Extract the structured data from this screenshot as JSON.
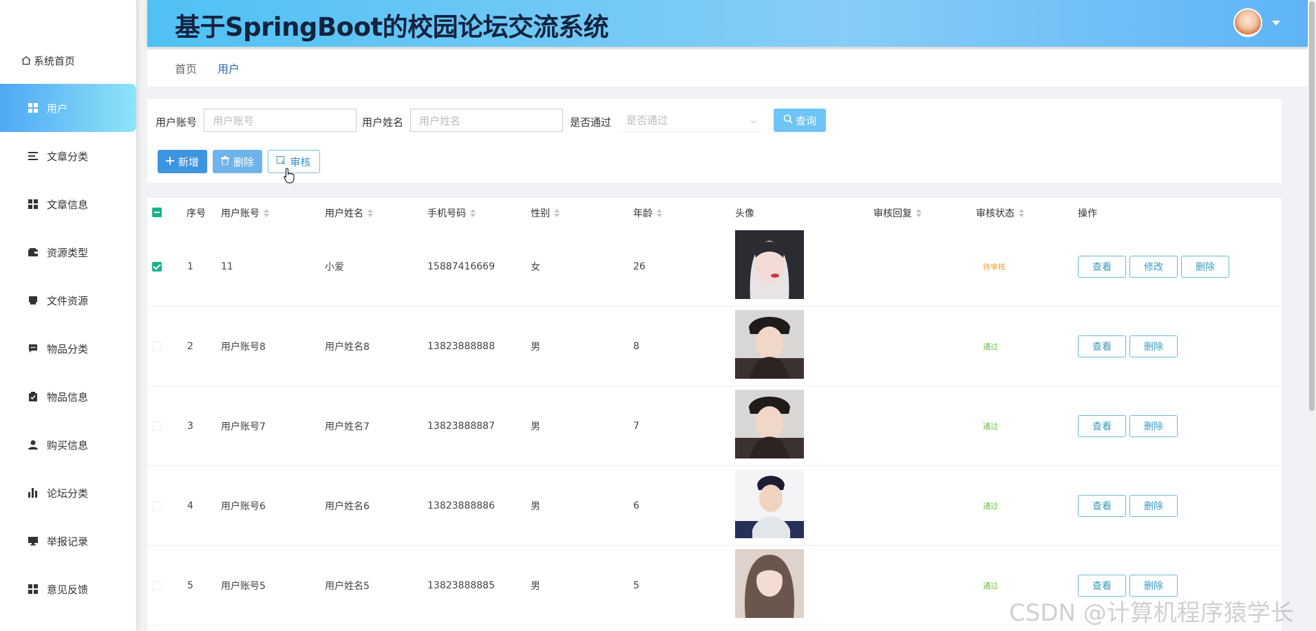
{
  "app": {
    "title": "基于SpringBoot的校园论坛交流系统"
  },
  "colors": {
    "accent": "#4fa8f5",
    "success": "#19b28a",
    "pending": "#e6a23c",
    "approved": "#67c23a"
  },
  "sidebar": {
    "home": {
      "label": "系统首页",
      "icon": "home-icon"
    },
    "items": [
      {
        "label": "用户",
        "icon": "grid-icon",
        "active": true
      },
      {
        "label": "文章分类",
        "icon": "list-icon"
      },
      {
        "label": "文章信息",
        "icon": "grid-icon"
      },
      {
        "label": "资源类型",
        "icon": "wallet-icon"
      },
      {
        "label": "文件资源",
        "icon": "printer-icon"
      },
      {
        "label": "物品分类",
        "icon": "chat-icon"
      },
      {
        "label": "物品信息",
        "icon": "clipboard-check-icon"
      },
      {
        "label": "购买信息",
        "icon": "user-icon"
      },
      {
        "label": "论坛分类",
        "icon": "bar-chart-icon"
      },
      {
        "label": "举报记录",
        "icon": "monitor-icon"
      },
      {
        "label": "意见反馈",
        "icon": "grid-icon"
      }
    ]
  },
  "breadcrumb": {
    "home": "首页",
    "current": "用户"
  },
  "search": {
    "account_label": "用户账号",
    "account_placeholder": "用户账号",
    "name_label": "用户姓名",
    "name_placeholder": "用户姓名",
    "passed_label": "是否通过",
    "passed_placeholder": "是否通过",
    "search_button": "查询"
  },
  "toolbar": {
    "add": "新增",
    "delete": "删除",
    "audit": "审核"
  },
  "table": {
    "headers": {
      "index": "序号",
      "account": "用户账号",
      "name": "用户姓名",
      "phone": "手机号码",
      "gender": "性别",
      "age": "年龄",
      "avatar": "头像",
      "reply": "审核回复",
      "status": "审核状态",
      "actions": "操作"
    },
    "rows": [
      {
        "index": "1",
        "account": "11",
        "name": "小爱",
        "phone": "15887416669",
        "gender": "女",
        "age": "26",
        "status": "待审核",
        "checked": true
      },
      {
        "index": "2",
        "account": "用户账号8",
        "name": "用户姓名8",
        "phone": "13823888888",
        "gender": "男",
        "age": "8",
        "status": "通过",
        "checked": false
      },
      {
        "index": "3",
        "account": "用户账号7",
        "name": "用户姓名7",
        "phone": "13823888887",
        "gender": "男",
        "age": "7",
        "status": "通过",
        "checked": false
      },
      {
        "index": "4",
        "account": "用户账号6",
        "name": "用户姓名6",
        "phone": "13823888886",
        "gender": "男",
        "age": "6",
        "status": "通过",
        "checked": false
      },
      {
        "index": "5",
        "account": "用户账号5",
        "name": "用户姓名5",
        "phone": "13823888885",
        "gender": "男",
        "age": "5",
        "status": "通过",
        "checked": false
      }
    ],
    "actions": {
      "view": "查看",
      "edit": "修改",
      "delete": "删除"
    }
  },
  "watermark": "CSDN @计算机程序猿学长"
}
